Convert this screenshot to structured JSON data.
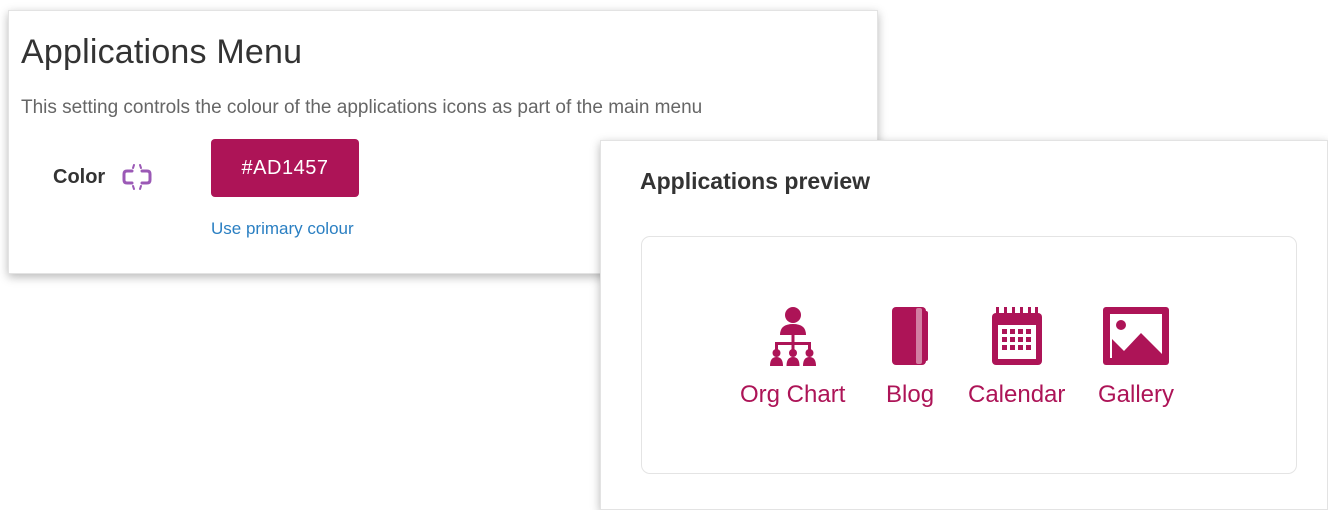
{
  "settings": {
    "title": "Applications Menu",
    "description": "This setting controls the colour of the applications icons as part of the main menu",
    "color_label": "Color",
    "color_value": "#AD1457",
    "use_primary_link": "Use primary colour",
    "unlink_icon": "unlink-icon",
    "unlink_icon_color": "#9b59b6"
  },
  "preview": {
    "title": "Applications preview",
    "accent_color": "#AD1457",
    "apps": [
      {
        "label": "Org Chart",
        "icon": "org-chart-icon"
      },
      {
        "label": "Blog",
        "icon": "notebook-icon"
      },
      {
        "label": "Calendar",
        "icon": "calendar-icon"
      },
      {
        "label": "Gallery",
        "icon": "image-icon"
      }
    ]
  }
}
